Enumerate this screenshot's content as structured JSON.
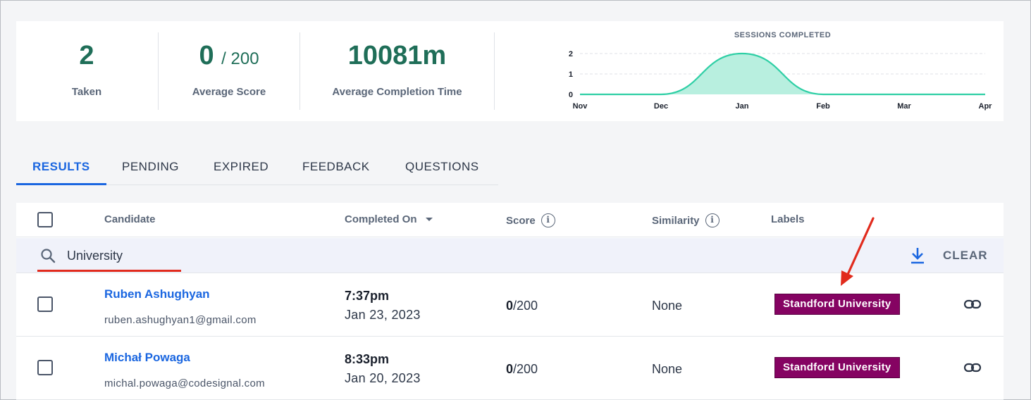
{
  "stats": {
    "taken": {
      "value": "2",
      "label": "Taken"
    },
    "average_score": {
      "value": "0",
      "sub": "/ 200",
      "label": "Average Score"
    },
    "average_completion": {
      "value": "10081m",
      "label": "Average Completion Time"
    }
  },
  "chart_data": {
    "type": "area",
    "title": "SESSIONS COMPLETED",
    "categories": [
      "Nov",
      "Dec",
      "Jan",
      "Feb",
      "Mar",
      "Apr"
    ],
    "values": [
      0,
      0,
      2,
      0,
      0,
      0
    ],
    "yticks": [
      "0",
      "1",
      "2"
    ],
    "ylim": [
      0,
      2
    ],
    "grid": true,
    "color": "#2ecfa5"
  },
  "tabs": [
    {
      "label": "RESULTS",
      "active": true
    },
    {
      "label": "PENDING"
    },
    {
      "label": "EXPIRED"
    },
    {
      "label": "FEEDBACK"
    },
    {
      "label": "QUESTIONS"
    }
  ],
  "table": {
    "headers": {
      "candidate": "Candidate",
      "completed_on": "Completed On",
      "score": "Score",
      "similarity": "Similarity",
      "labels": "Labels"
    },
    "search": {
      "value": "University",
      "clear_label": "CLEAR"
    },
    "rows": [
      {
        "name": "Ruben Ashughyan",
        "email": "ruben.ashughyan1@gmail.com",
        "time": "7:37pm",
        "date": "Jan 23, 2023",
        "score": "0",
        "score_total": "/200",
        "similarity": "None",
        "label": "Standford University"
      },
      {
        "name": "Michał Powaga",
        "email": "michal.powaga@codesignal.com",
        "time": "8:33pm",
        "date": "Jan 20, 2023",
        "score": "0",
        "score_total": "/200",
        "similarity": "None",
        "label": "Standford University"
      }
    ]
  },
  "colors": {
    "accent": "#1a66e0",
    "stat": "#1f6e58",
    "label": "#850362",
    "annotation": "#e12b1d"
  }
}
